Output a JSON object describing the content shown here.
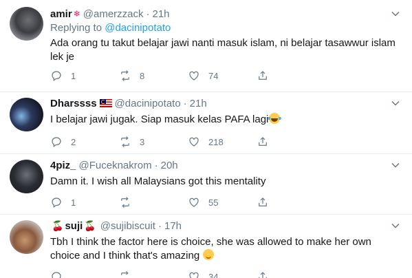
{
  "tweets": [
    {
      "name": "amir",
      "handle": "@amerzzack",
      "separator": "·",
      "time": "21h",
      "reply_prefix": "Replying to ",
      "reply_to": "@dacinipotato",
      "text": "Ada orang tu takut belajar jawi nanti masuk islam, ni belajar tasawwur islam lek je",
      "replies": "1",
      "retweets": "8",
      "likes": "74"
    },
    {
      "name": "Dharssss",
      "handle": "@dacinipotato",
      "separator": "·",
      "time": "21h",
      "text": "I belajar jawi jugak. Siap masuk kelas PAFA lagi",
      "replies": "2",
      "retweets": "3",
      "likes": "218"
    },
    {
      "name": "4piz_",
      "handle": "@Fuceknakrom",
      "separator": "·",
      "time": "20h",
      "text": "Damn it. I wish all Malaysians got this mentality",
      "replies": "1",
      "retweets": "",
      "likes": "55"
    },
    {
      "name": "suji",
      "handle": "@sujibiscuit",
      "separator": "·",
      "time": "17h",
      "text": "Tbh I think the factor here is choice, she was allowed to make her own choice and I think that's amazing",
      "replies": "",
      "retweets": "",
      "likes": "34"
    }
  ],
  "icons": {
    "reply": "reply-icon",
    "retweet": "retweet-icon",
    "like": "heart-icon",
    "share": "share-icon",
    "more": "chevron-down-icon"
  },
  "colors": {
    "link": "#1da1f2",
    "muted": "#657786",
    "text": "#14171a"
  }
}
